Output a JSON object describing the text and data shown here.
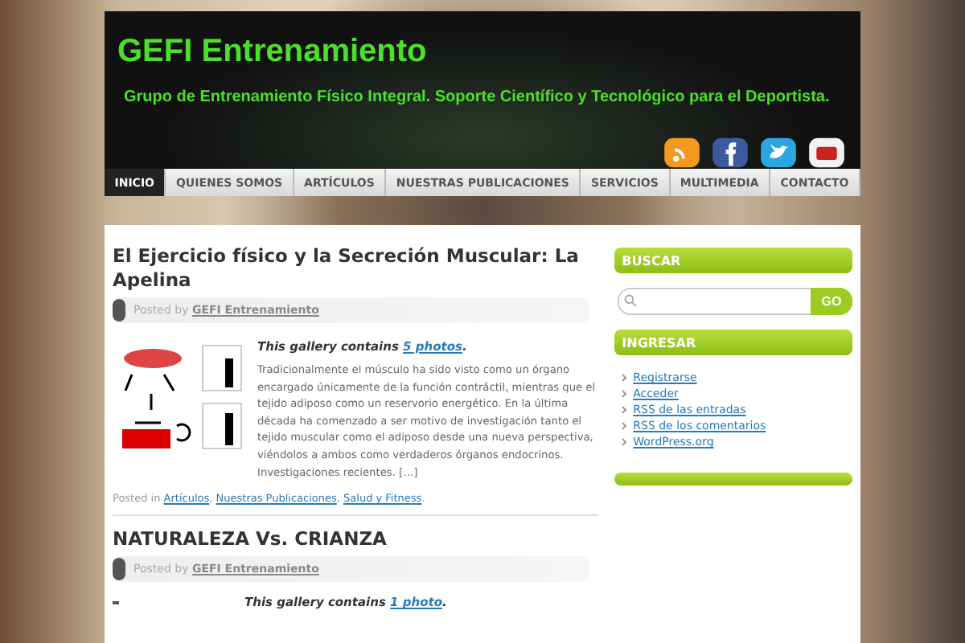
{
  "site": {
    "title": "GEFI Entrenamiento",
    "tagline": "Grupo de Entrenamiento Físico Integral. Soporte Científico y Tecnológico para el Deportista."
  },
  "nav": [
    {
      "label": "INICIO",
      "selected": true
    },
    {
      "label": "QUIENES SOMOS",
      "selected": false
    },
    {
      "label": "ARTÍCULOS",
      "selected": false
    },
    {
      "label": "NUESTRAS PUBLICACIONES",
      "selected": false
    },
    {
      "label": "SERVICIOS",
      "selected": false
    },
    {
      "label": "MULTIMEDIA",
      "selected": false
    },
    {
      "label": "CONTACTO",
      "selected": false
    }
  ],
  "posts": [
    {
      "title": "El Ejercicio físico y la Secreción Muscular: La Apelina",
      "posted_by": "Posted by",
      "author": "GEFI Entrenamiento",
      "gallery_text": "This gallery contains",
      "gallery_link": "5 photos",
      "gallery_end": ".",
      "excerpt": "Tradicionalmente el músculo ha sido visto como un órgano encargado únicamente de la función contráctil, mientras que el tejido adiposo como un reservorio energético. En la última década ha comenzado a ser motivo de investigación tanto el tejido muscular como el adiposo desde una nueva perspectiva, viéndolos a ambos como verdaderos órganos endocrinos. Investigaciones recientes. […]",
      "posted_in": "Posted in",
      "categories": [
        "Artículos",
        "Nuestras Publicaciones",
        "Salud y Fitness"
      ],
      "separator": ",",
      "end": "."
    },
    {
      "title": "NATURALEZA Vs. CRIANZA",
      "posted_by": "Posted by",
      "author": "GEFI Entrenamiento",
      "gallery_text": "This gallery contains",
      "gallery_link": "1 photo",
      "gallery_end": "."
    }
  ],
  "sidebar": {
    "search": {
      "title": "BUSCAR",
      "button": "GO"
    },
    "widgets": [
      {
        "title": "INGRESAR",
        "links": [
          "Registrarse",
          "Acceder",
          "RSS de las entradas",
          "RSS de los comentarios",
          "WordPress.org"
        ]
      }
    ]
  }
}
